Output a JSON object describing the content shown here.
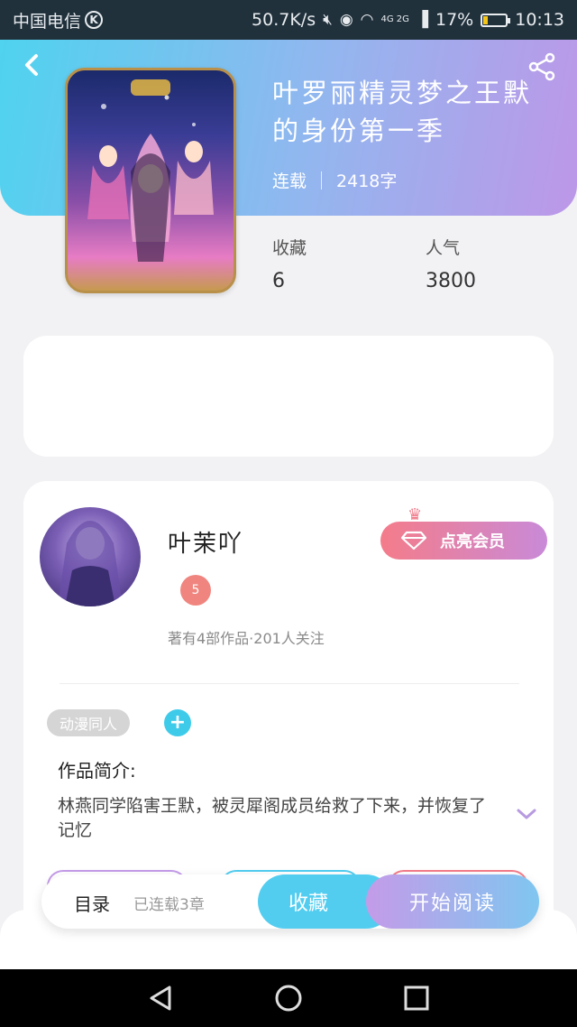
{
  "status_bar": {
    "carrier": "中国电信",
    "carrier_badge": "K",
    "speed": "50.7K/s",
    "network": "4G 2G",
    "battery_percent": "17%",
    "battery_level": 0.17,
    "time": "10:13"
  },
  "header": {
    "back_icon": "chevron-left-icon",
    "share_icon": "share-icon",
    "title": "叶罗丽精灵梦之王默的身份第一季",
    "status": "连载",
    "word_count": "2418字"
  },
  "stats": {
    "favorites_label": "收藏",
    "favorites_value": "6",
    "popularity_label": "人气",
    "popularity_value": "3800"
  },
  "author": {
    "name": "叶茉吖",
    "level_badge": "5",
    "vip_button": "点亮会员",
    "meta": "著有4部作品·201人关注"
  },
  "tags": {
    "items": [
      "动漫同人"
    ],
    "add_icon": "plus-icon"
  },
  "intro": {
    "label": "作品简介:",
    "text": "林燕同学陷害王默，被灵犀阁成员给救了下来，并恢复了记忆"
  },
  "bottom_bar": {
    "toc_label": "目录",
    "chapter_count": "已连载3章",
    "favorite_button": "收藏",
    "read_button": "开始阅读"
  },
  "colors": {
    "header_start": "#4fd3ef",
    "header_end": "#bd97e8",
    "accent_cyan": "#52cdf0",
    "vip_pink": "#f47c8a"
  }
}
